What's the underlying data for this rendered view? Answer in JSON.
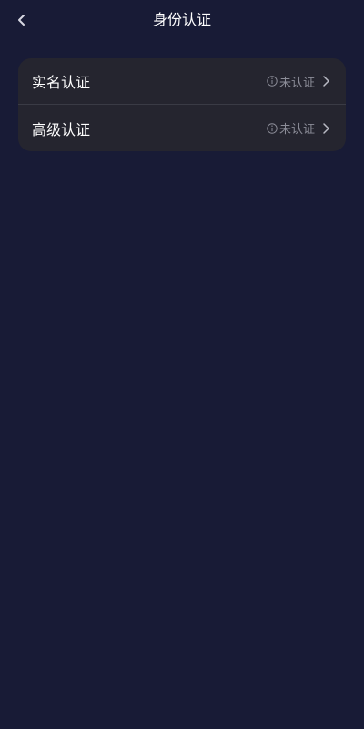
{
  "header": {
    "title": "身份认证",
    "back_icon": "chevron-left-icon"
  },
  "colors": {
    "background": "#181b36",
    "card": "#25252f",
    "status_text": "#8c8d98"
  },
  "verification_items": [
    {
      "label": "实名认证",
      "status": "未认证",
      "status_icon": "info-icon",
      "arrow_icon": "chevron-right-icon"
    },
    {
      "label": "高级认证",
      "status": "未认证",
      "status_icon": "info-icon",
      "arrow_icon": "chevron-right-icon"
    }
  ]
}
